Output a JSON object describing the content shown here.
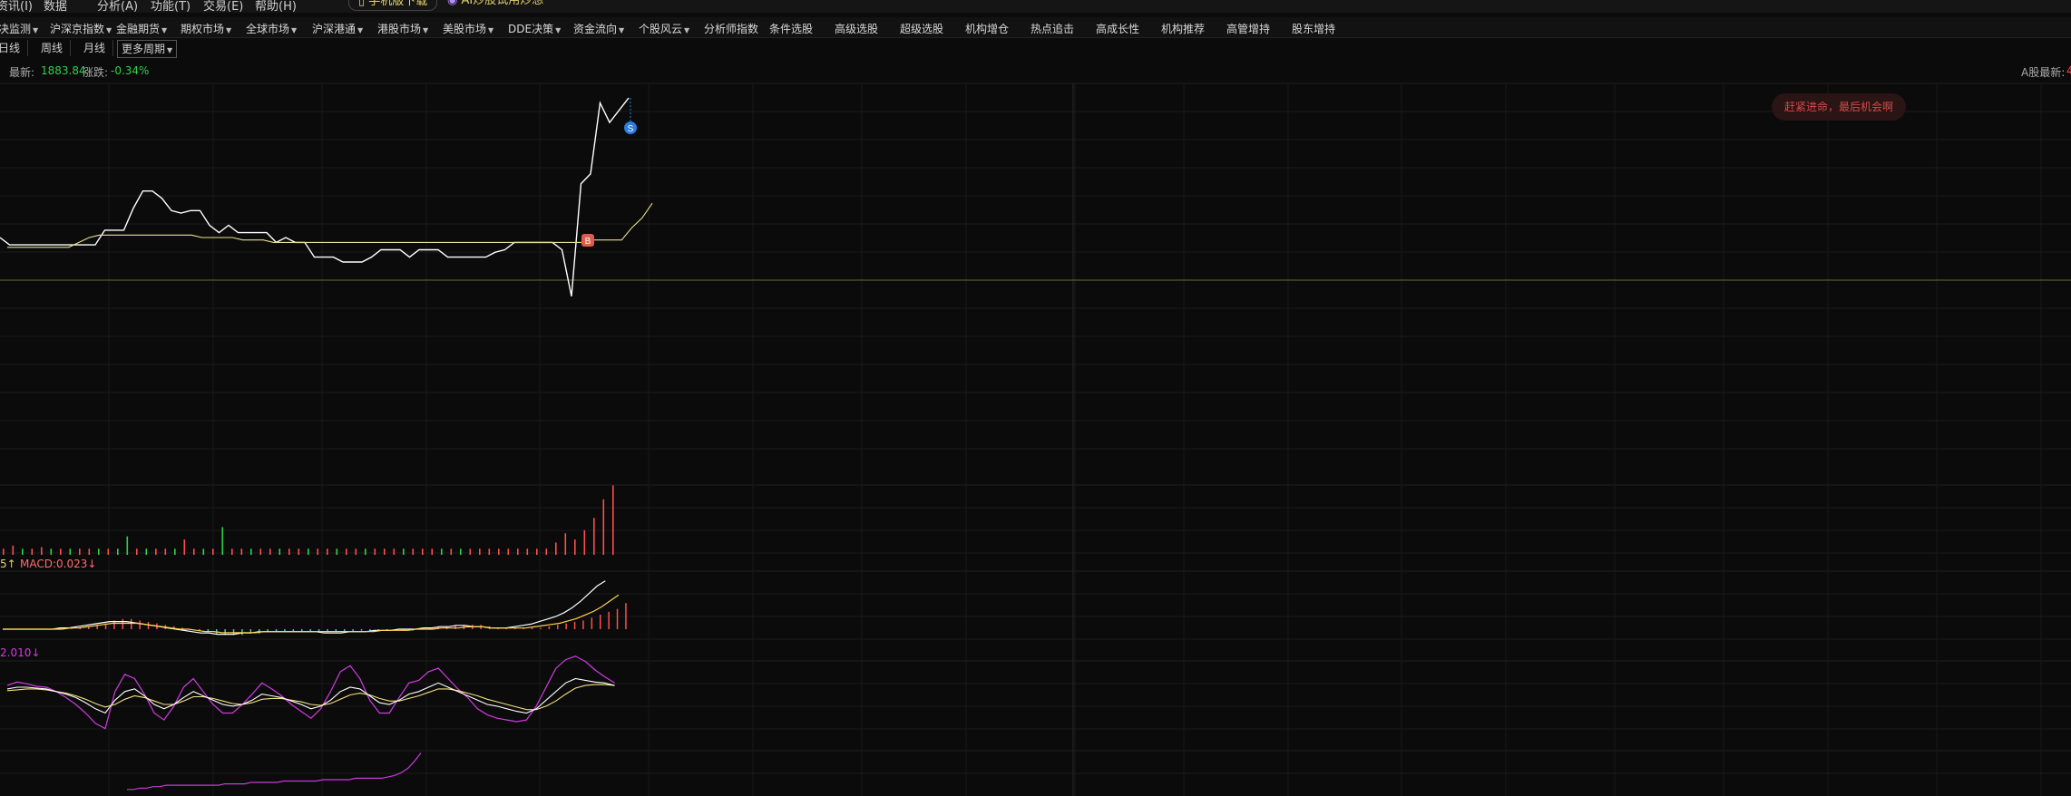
{
  "top_menu": {
    "items": [
      "资讯(I)",
      "数据",
      "分析(A)",
      "功能(T)",
      "交易(E)",
      "帮助(H)"
    ],
    "download_label": "手机版下载",
    "ai_label": "AI炒股试用炒想"
  },
  "nav": {
    "items": [
      "决监测",
      "沪深京指数",
      "金融期货",
      "期权市场",
      "全球市场",
      "沪深港通",
      "港股市场",
      "美股市场",
      "DDE决策",
      "资金流向",
      "个股风云",
      "分析师指数",
      "条件选股",
      "高级选股",
      "超级选股",
      "机构增仓",
      "热点追击",
      "高成长性",
      "机构推荐",
      "高管增持",
      "股东增持"
    ]
  },
  "period": {
    "items": [
      "日线",
      "周线",
      "月线"
    ],
    "more_label": "更多周期"
  },
  "info": {
    "latest_label": "最新:",
    "latest_value": "1883.84",
    "change_label": "涨跌:",
    "change_value": "-0.34%",
    "a_share_label": "A股最新:",
    "a_share_value": "4"
  },
  "banner_text": "赶紧进命，最后机会啊",
  "markers": {
    "buy": "B",
    "sell": "S"
  },
  "indicators": {
    "macd_prefix": "5↑",
    "macd_label": "MACD:0.023↓",
    "kdj_label": "2.010↓"
  },
  "colors": {
    "background": "#0b0b0c",
    "price_line": "#ffffff",
    "ma_line": "#e8e28a",
    "up": "#ff4d4d",
    "down": "#2fd14c",
    "macd_dif": "#ffffff",
    "macd_dea": "#ffd24a",
    "kdj_k": "#ffffff",
    "kdj_d": "#f4e07a",
    "kdj_j": "#d13be0",
    "bottom_line": "#c73ad8"
  },
  "chart_data": {
    "type": "line",
    "series": [
      {
        "values": [
          60,
          63,
          63,
          63,
          63,
          63,
          63,
          63,
          63,
          63,
          63,
          57,
          57,
          57,
          48,
          41,
          41,
          44,
          49,
          50,
          49,
          49,
          55,
          58,
          55,
          58,
          58,
          58,
          58,
          62,
          60,
          62,
          62,
          68,
          68,
          68,
          70,
          70,
          70,
          68,
          65,
          65,
          65,
          68,
          65,
          65,
          65,
          68,
          68,
          68,
          68,
          68,
          66,
          65,
          62,
          62,
          62,
          62,
          62,
          65,
          84,
          38,
          34,
          5,
          13,
          8,
          3
        ]
      },
      {
        "values": [
          64,
          64,
          64,
          64,
          64,
          64,
          64,
          62,
          60,
          59,
          59,
          59,
          59,
          59,
          59,
          59,
          59,
          59,
          59,
          60,
          60,
          60,
          60,
          61,
          61,
          61,
          62,
          62,
          62,
          62,
          62,
          62,
          62,
          62,
          62,
          62,
          62,
          62,
          62,
          62,
          62,
          62,
          62,
          62,
          62,
          62,
          62,
          62,
          62,
          62,
          62,
          62,
          62,
          62,
          62,
          62,
          62,
          61,
          61,
          61,
          61,
          56,
          52,
          46
        ]
      }
    ],
    "volume": {
      "values": [
        4,
        6,
        4,
        4,
        5,
        4,
        4,
        4,
        4,
        4,
        4,
        4,
        4,
        12,
        4,
        4,
        4,
        4,
        4,
        10,
        4,
        4,
        4,
        18,
        4,
        4,
        4,
        4,
        4,
        4,
        4,
        4,
        4,
        4,
        4,
        4,
        4,
        4,
        4,
        4,
        4,
        4,
        4,
        4,
        4,
        4,
        4,
        4,
        4,
        4,
        4,
        4,
        4,
        4,
        4,
        4,
        4,
        4,
        8,
        14,
        10,
        16,
        24,
        36,
        45
      ],
      "colors": [
        "up",
        "up",
        "down",
        "up",
        "up",
        "down",
        "up",
        "down",
        "up",
        "up",
        "down",
        "up",
        "down",
        "down",
        "up",
        "down",
        "up",
        "up",
        "down",
        "up",
        "up",
        "down",
        "up",
        "down",
        "up",
        "up",
        "down",
        "up",
        "up",
        "down",
        "up",
        "up",
        "down",
        "up",
        "up",
        "down",
        "up",
        "up",
        "down",
        "up",
        "up",
        "up",
        "down",
        "up",
        "up",
        "up",
        "down",
        "up",
        "down",
        "up",
        "up",
        "up",
        "up",
        "up",
        "up",
        "up",
        "up",
        "up",
        "up",
        "up",
        "up",
        "up",
        "up",
        "up",
        "up"
      ]
    },
    "macd": {
      "hist": [
        0,
        0,
        0,
        0,
        0,
        0,
        0,
        0,
        1,
        1,
        2,
        3,
        4,
        6,
        7,
        7,
        6,
        5,
        4,
        3,
        2,
        1,
        0,
        -1,
        -2,
        -3,
        -4,
        -4,
        -4,
        -3,
        -3,
        -2,
        -2,
        -2,
        -2,
        -2,
        -2,
        -2,
        -2,
        -2,
        -2,
        -2,
        -1,
        -1,
        -1,
        -1,
        -1,
        -1,
        -1,
        0,
        1,
        2,
        2,
        3,
        3,
        3,
        3,
        2,
        1,
        1,
        1,
        1,
        1,
        1,
        2,
        3,
        4,
        5,
        6,
        8,
        10,
        12,
        14,
        18
      ],
      "dif": [
        0,
        0,
        0,
        0,
        0,
        0,
        0,
        1,
        1,
        2,
        3,
        4,
        5,
        6,
        6,
        6,
        5,
        4,
        3,
        2,
        1,
        0,
        -1,
        -2,
        -3,
        -3,
        -4,
        -4,
        -4,
        -3,
        -3,
        -2,
        -2,
        -2,
        -2,
        -2,
        -2,
        -2,
        -2,
        -3,
        -3,
        -3,
        -2,
        -2,
        -2,
        -1,
        -1,
        -1,
        0,
        0,
        0,
        1,
        1,
        2,
        2,
        3,
        3,
        2,
        2,
        1,
        1,
        1,
        2,
        3,
        4,
        6,
        8,
        10,
        13,
        17,
        22,
        28,
        34,
        38
      ],
      "dea": [
        0,
        0,
        0,
        0,
        0,
        0,
        0,
        0,
        1,
        1,
        2,
        3,
        4,
        5,
        5,
        5,
        5,
        4,
        3,
        2,
        1,
        0,
        0,
        -1,
        -2,
        -2,
        -3,
        -3,
        -3,
        -3,
        -3,
        -2,
        -2,
        -2,
        -2,
        -2,
        -2,
        -2,
        -2,
        -2,
        -2,
        -2,
        -2,
        -2,
        -2,
        -1,
        -1,
        -1,
        -1,
        0,
        0,
        0,
        1,
        1,
        1,
        2,
        2,
        2,
        1,
        1,
        1,
        1,
        1,
        2,
        3,
        4,
        5,
        7,
        9,
        12,
        15,
        19,
        24,
        29
      ]
    },
    "kdj": {
      "k": [
        58,
        60,
        60,
        59,
        58,
        55,
        52,
        48,
        42,
        35,
        30,
        45,
        55,
        58,
        50,
        40,
        35,
        40,
        48,
        55,
        50,
        45,
        40,
        38,
        40,
        45,
        52,
        50,
        48,
        44,
        40,
        35,
        38,
        45,
        55,
        60,
        58,
        50,
        42,
        40,
        45,
        52,
        55,
        60,
        65,
        60,
        55,
        50,
        45,
        40,
        38,
        35,
        32,
        30,
        35,
        45,
        55,
        65,
        70,
        68,
        66,
        65,
        62
      ],
      "d": [
        56,
        57,
        58,
        58,
        57,
        55,
        53,
        50,
        46,
        41,
        37,
        40,
        46,
        50,
        48,
        44,
        40,
        40,
        44,
        49,
        49,
        47,
        44,
        41,
        40,
        42,
        46,
        47,
        47,
        45,
        43,
        40,
        39,
        41,
        46,
        51,
        53,
        51,
        47,
        44,
        44,
        47,
        50,
        54,
        58,
        58,
        56,
        53,
        50,
        46,
        43,
        40,
        37,
        34,
        34,
        38,
        44,
        52,
        59,
        62,
        63,
        63,
        62
      ],
      "j": [
        62,
        66,
        64,
        61,
        60,
        55,
        48,
        40,
        30,
        18,
        12,
        55,
        75,
        70,
        52,
        30,
        22,
        38,
        60,
        70,
        55,
        40,
        30,
        30,
        40,
        52,
        65,
        58,
        50,
        40,
        32,
        24,
        35,
        55,
        78,
        85,
        70,
        45,
        30,
        30,
        48,
        65,
        68,
        78,
        82,
        70,
        58,
        48,
        35,
        28,
        24,
        22,
        20,
        22,
        38,
        60,
        82,
        92,
        96,
        90,
        80,
        72,
        65
      ]
    },
    "bottom": {
      "values": [
        4,
        4,
        5,
        5,
        6,
        6,
        7,
        7,
        7,
        7,
        7,
        7,
        7,
        7,
        7,
        8,
        8,
        8,
        8,
        9,
        9,
        9,
        9,
        9,
        10,
        10,
        10,
        10,
        10,
        10,
        11,
        11,
        11,
        11,
        11,
        12,
        12,
        12,
        12,
        12,
        13,
        14,
        16,
        19,
        24,
        30
      ]
    }
  }
}
